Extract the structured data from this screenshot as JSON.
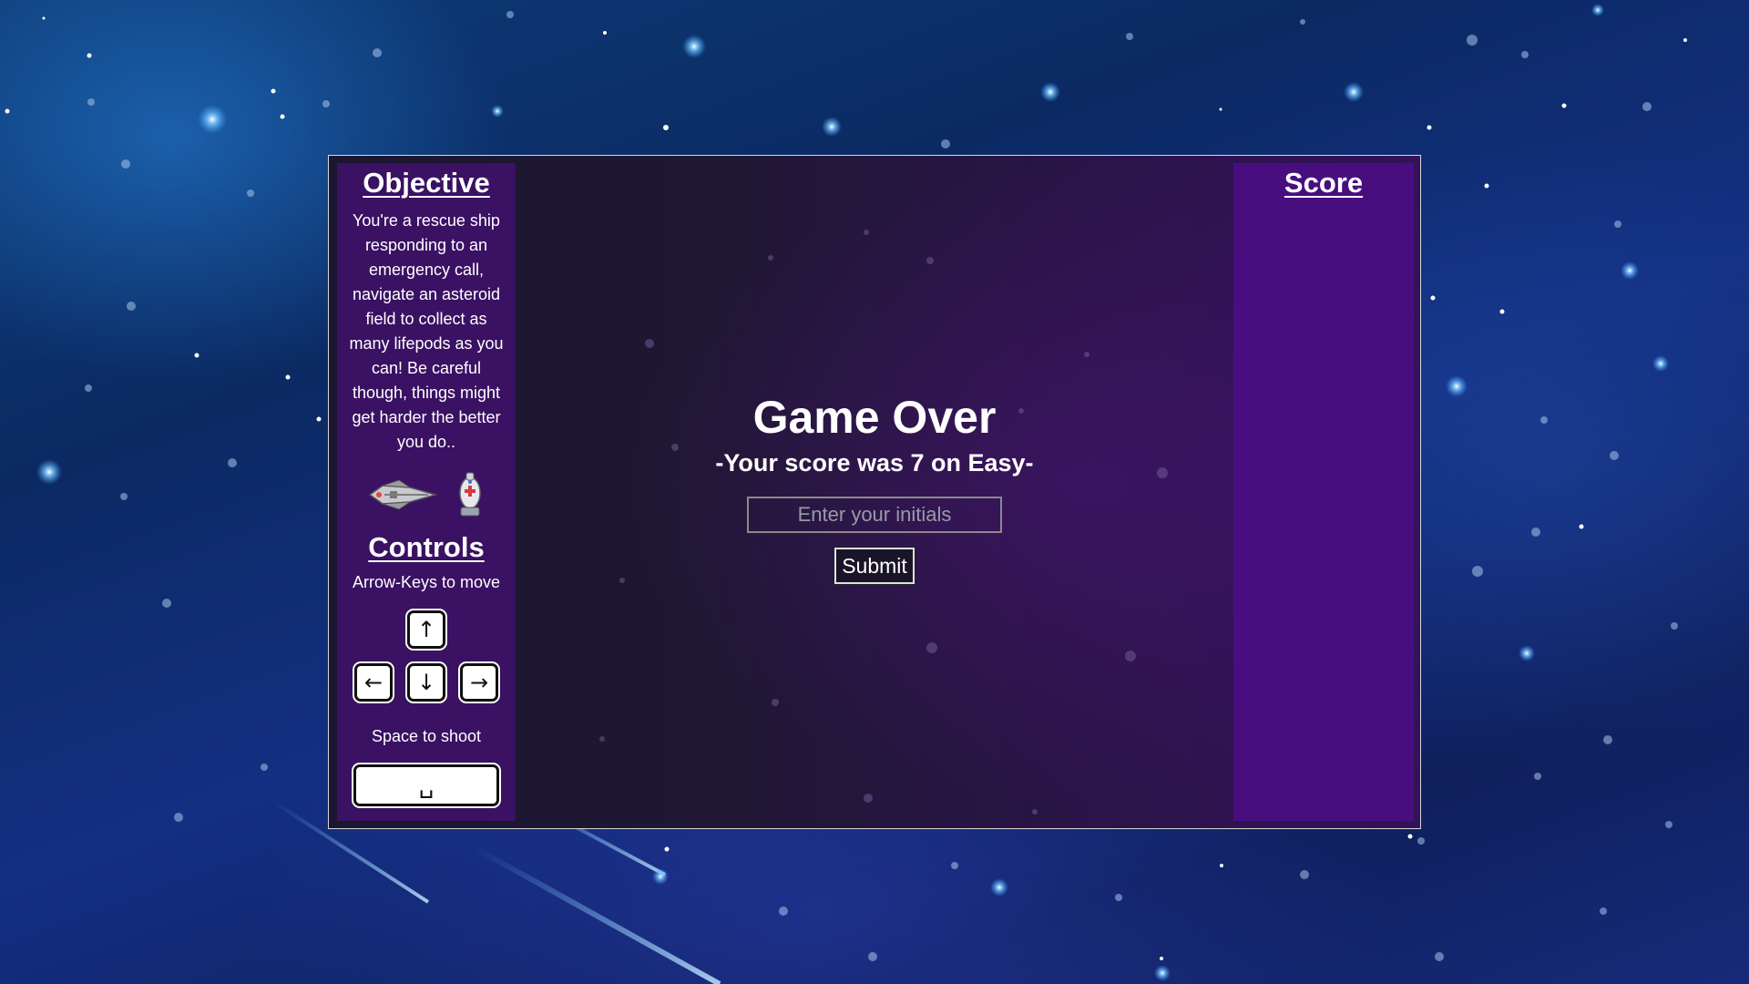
{
  "background": {
    "colors": {
      "deep_blue": "#0b2a63",
      "bright_blue": "#2a82dc",
      "star": "#ffffff",
      "glow_star": "#8fd0ff"
    }
  },
  "objective": {
    "title": "Objective",
    "text": "You're a rescue ship responding to an emergency call, navigate an asteroid field to collect as many lifepods as you can! Be careful though, things might get harder the better you do..",
    "icons": [
      "rescue-ship-icon",
      "lifepod-icon"
    ]
  },
  "controls": {
    "title": "Controls",
    "move_text": "Arrow-Keys to move",
    "keys": {
      "up": "↑",
      "left": "←",
      "down": "↓",
      "right": "→"
    },
    "shoot_text": "Space to shoot",
    "space_key": "␣"
  },
  "score_panel": {
    "title": "Score"
  },
  "game_over": {
    "title": "Game Over",
    "subtitle": "-Your score was 7 on Easy-",
    "score": 7,
    "difficulty": "Easy",
    "initials_placeholder": "Enter your initials",
    "initials_value": "",
    "submit_label": "Submit"
  },
  "colors": {
    "left_panel": "#3a1163",
    "right_panel": "#480e80",
    "game_area": "#1f1733",
    "frame_border": "#d9d9d9",
    "text": "#ffffff"
  }
}
